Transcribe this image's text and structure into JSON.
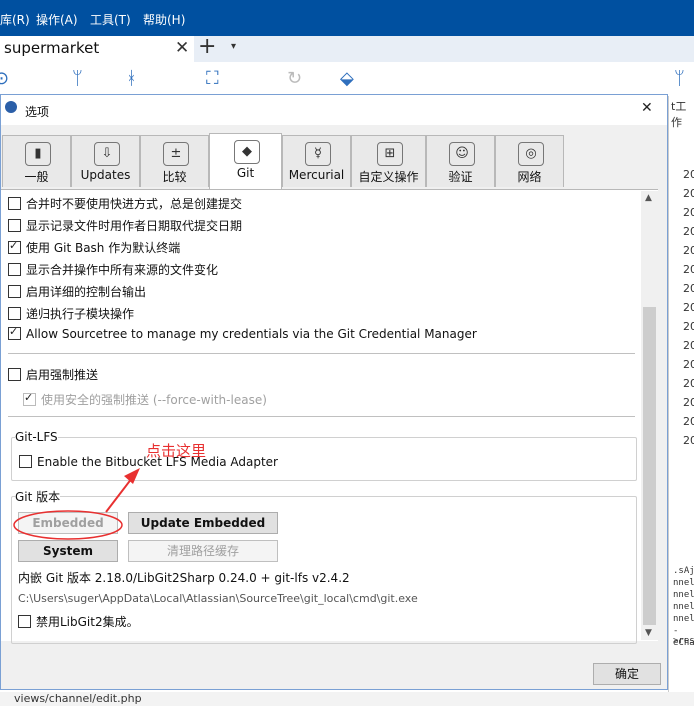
{
  "menubar": {
    "items": [
      "库(R)",
      "操作(A)",
      "工具(T)",
      "帮助(H)"
    ]
  },
  "app_tab": {
    "label": "supermarket",
    "close": "✕",
    "new_tab": "+",
    "dropdown": "▾"
  },
  "toolbar_icons": [
    "commit-icon",
    "pull-icon",
    "branch-icon",
    "remote-icon",
    "refresh-icon",
    "tag-icon"
  ],
  "right_panel": {
    "header": "t工作",
    "rows": [
      "20",
      "20",
      "20",
      "20",
      "20",
      "20",
      "20",
      "20",
      "20",
      "20",
      "20",
      "20",
      "20",
      "20",
      "20"
    ],
    "code": [
      ".sAja",
      "nnel",
      "nnel",
      "nnel-",
      "nnel-",
      "->res",
      "eChar"
    ]
  },
  "bottom_file": "views/channel/edit.php",
  "dialog": {
    "title": "选项",
    "close": "✕",
    "tabs": [
      {
        "label": "一般",
        "icon": "general-icon",
        "glyph": "▮"
      },
      {
        "label": "Updates",
        "icon": "updates-icon",
        "glyph": "⇩"
      },
      {
        "label": "比较",
        "icon": "diff-icon",
        "glyph": "±"
      },
      {
        "label": "Git",
        "icon": "git-icon",
        "glyph": "◆",
        "active": true
      },
      {
        "label": "Mercurial",
        "icon": "mercurial-icon",
        "glyph": "☿"
      },
      {
        "label": "自定义操作",
        "icon": "custom-actions-icon",
        "glyph": "⊞"
      },
      {
        "label": "验证",
        "icon": "auth-icon",
        "glyph": "☺"
      },
      {
        "label": "网络",
        "icon": "network-icon",
        "glyph": "◎"
      }
    ],
    "options": [
      {
        "label": "合并时不要使用快进方式，总是创建提交",
        "checked": false
      },
      {
        "label": "显示记录文件时用作者日期取代提交日期",
        "checked": false
      },
      {
        "label": "使用 Git Bash 作为默认终端",
        "checked": true
      },
      {
        "label": "显示合并操作中所有来源的文件变化",
        "checked": false
      },
      {
        "label": "启用详细的控制台输出",
        "checked": false
      },
      {
        "label": "递归执行子模块操作",
        "checked": false
      },
      {
        "label": "Allow Sourcetree to manage my credentials via the Git Credential Manager",
        "checked": true
      }
    ],
    "force_push": {
      "label": "启用强制推送",
      "checked": false
    },
    "force_with_lease": {
      "label": "使用安全的强制推送 (--force-with-lease)",
      "checked": true,
      "disabled": true
    },
    "lfs": {
      "title": "Git-LFS",
      "option": "Enable the Bitbucket LFS Media Adapter",
      "checked": false
    },
    "git_version": {
      "title": "Git 版本",
      "embedded_button": "Embedded",
      "update_embedded_button": "Update Embedded",
      "system_button": "System",
      "clear_path_button": "清理路径缓存",
      "version_info": "内嵌 Git 版本 2.18.0/LibGit2Sharp 0.24.0 + git-lfs v2.4.2",
      "path": "C:\\Users\\suger\\AppData\\Local\\Atlassian\\SourceTree\\git_local\\cmd\\git.exe",
      "disable_libgit2": {
        "label": "禁用LibGit2集成。",
        "checked": false
      }
    },
    "ok_button": "确定"
  },
  "annotation": {
    "text": "点击这里",
    "color": "#e83030"
  }
}
